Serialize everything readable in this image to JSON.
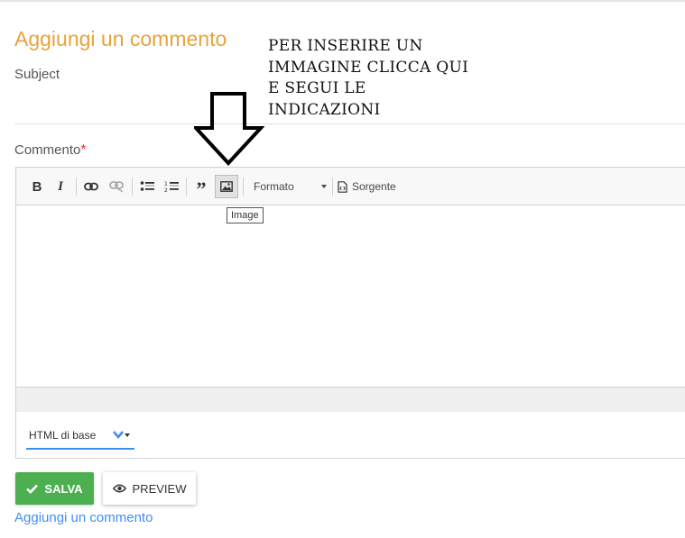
{
  "form": {
    "title": "Aggiungi un commento",
    "subject_label": "Subject",
    "comment_label": "Commento",
    "required_mark": "*"
  },
  "toolbar": {
    "bold": "B",
    "italic": "I",
    "link_icon": "link-icon",
    "unlink_icon": "unlink-icon",
    "bulleted_icon": "bulleted-list-icon",
    "numbered_icon": "numbered-list-icon",
    "quote": "”",
    "image_icon": "image-icon",
    "format_label": "Formato",
    "source_label": "Sorgente"
  },
  "tooltip": "Image",
  "text_format": {
    "selected": "HTML di base"
  },
  "buttons": {
    "save": "SALVA",
    "preview": "PREVIEW"
  },
  "footer_link": "Aggiungi un commento",
  "annotation": "Per inserire un immagine clicca qui e segui le indicazioni",
  "colors": {
    "title": "#e8a33a",
    "save": "#4caf50",
    "link": "#3f8ef5",
    "required": "#e53935"
  }
}
